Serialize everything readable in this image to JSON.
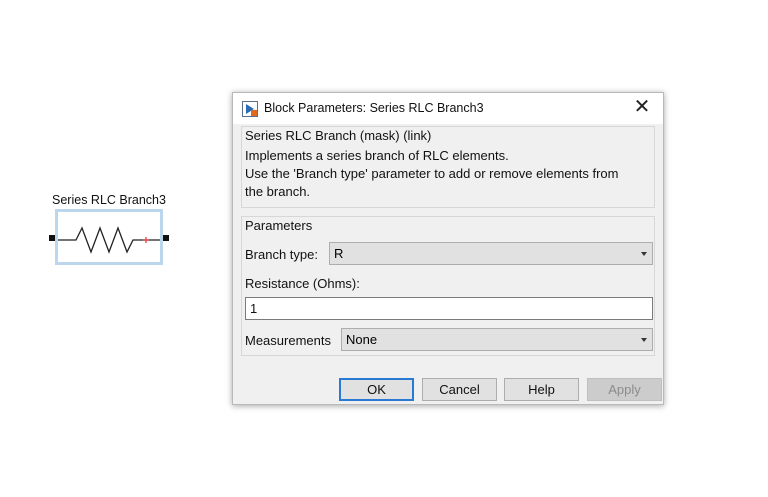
{
  "block": {
    "name": "Series RLC Branch3"
  },
  "dialog": {
    "title": "Block Parameters: Series RLC Branch3",
    "close_glyph": "✕",
    "header_group": {
      "title": "Series RLC Branch (mask) (link)",
      "description_line1": "Implements a series branch of RLC elements.",
      "description_line2": "Use the 'Branch type' parameter to add or remove elements from",
      "description_line3": "the branch."
    },
    "parameters": {
      "title": "Parameters",
      "branch_type_label": "Branch type:",
      "branch_type_value": "R",
      "resistance_label": "Resistance (Ohms):",
      "resistance_value": "1",
      "measurements_label": "Measurements",
      "measurements_value": "None"
    },
    "buttons": {
      "ok": "OK",
      "cancel": "Cancel",
      "help": "Help",
      "apply": "Apply"
    }
  },
  "colors": {
    "accent": "#2a7ad3",
    "block_border": "#bcd6ee",
    "dialog_bg": "#f0f0f0"
  }
}
